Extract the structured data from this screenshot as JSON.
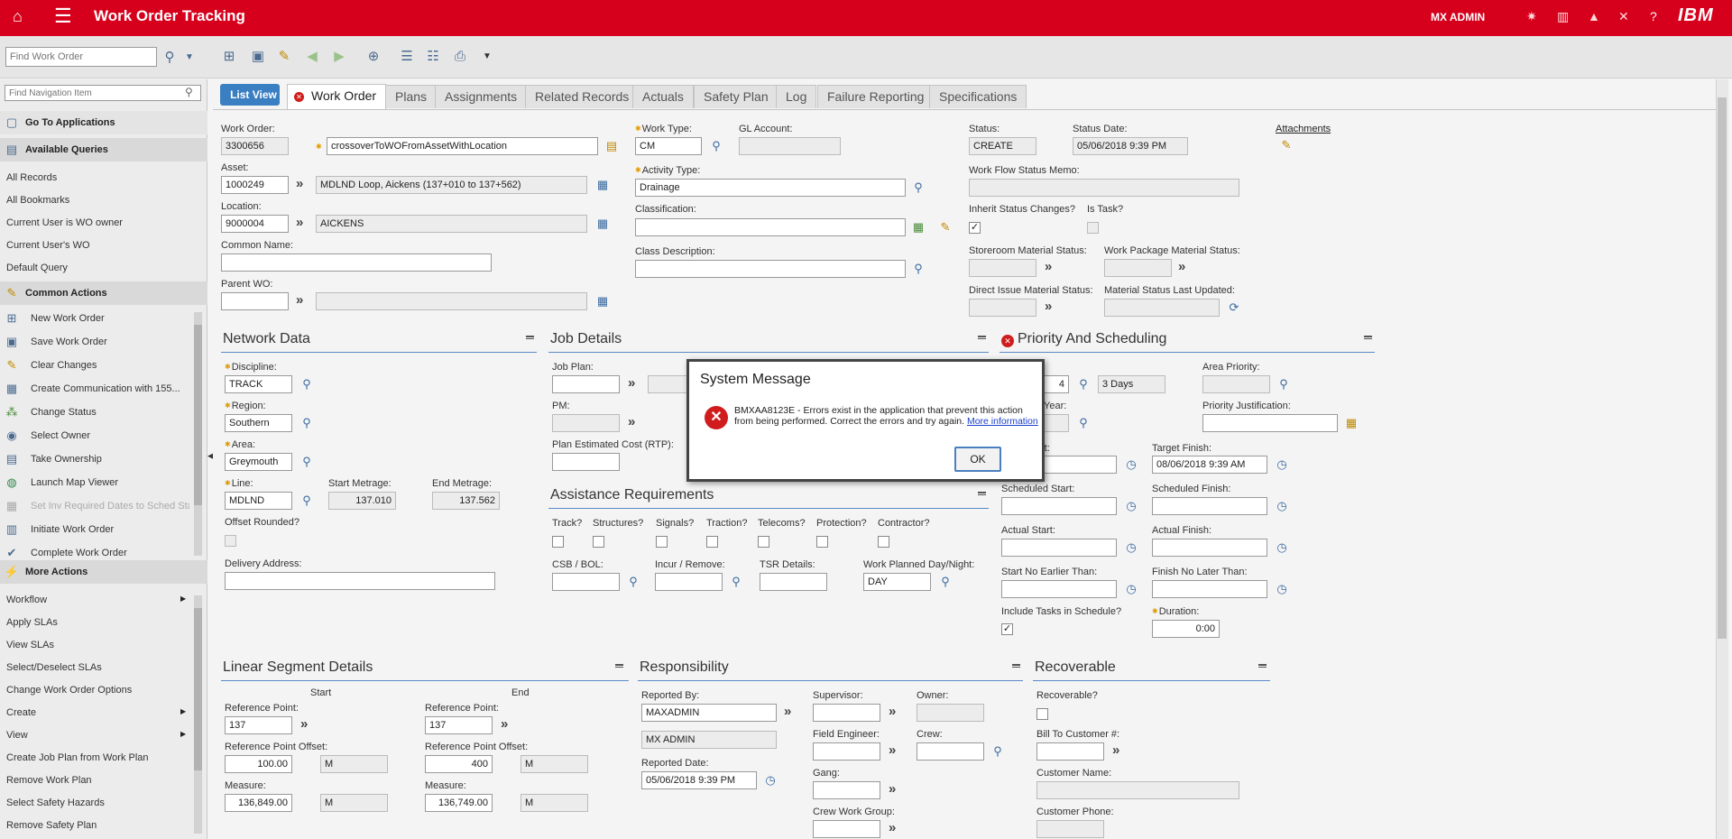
{
  "app": {
    "title": "Work Order Tracking",
    "user": "MX ADMIN",
    "brand": "IBM",
    "accent": "#d6001c"
  },
  "toolbar": {
    "find_placeholder": "Find Work Order"
  },
  "nav": {
    "search_placeholder": "Find Navigation Item",
    "go_to_apps": "Go To Applications",
    "available_queries": "Available Queries",
    "queries": [
      "All Records",
      "All Bookmarks",
      "Current User is WO owner",
      "Current User's WO",
      "Default Query"
    ],
    "common_actions": "Common Actions",
    "actions": [
      "New Work Order",
      "Save Work Order",
      "Clear Changes",
      "Create Communication with 155...",
      "Change Status",
      "Select Owner",
      "Take Ownership",
      "Launch Map Viewer",
      "Set Inv Required Dates to Sched Sta",
      "Initiate Work Order",
      "Complete Work Order"
    ],
    "more_actions": "More Actions",
    "more": [
      "Workflow",
      "Apply SLAs",
      "View SLAs",
      "Select/Deselect SLAs",
      "Change Work Order Options",
      "Create",
      "View",
      "Create Job Plan from Work Plan",
      "Remove Work Plan",
      "Select Safety Hazards",
      "Remove Safety Plan"
    ]
  },
  "tabs": {
    "list_view": "List View",
    "items": [
      "Work Order",
      "Plans",
      "Assignments",
      "Related Records",
      "Actuals",
      "Safety Plan",
      "Log",
      "Failure Reporting",
      "Specifications"
    ]
  },
  "header": {
    "wo_label": "Work Order:",
    "wo": "3300656",
    "desc": "crossoverToWOFromAssetWithLocation",
    "asset_label": "Asset:",
    "asset": "1000249",
    "asset_desc": "MDLND Loop, Aickens (137+010 to 137+562)",
    "location_label": "Location:",
    "location": "9000004",
    "location_desc": "AICKENS",
    "common_name_label": "Common Name:",
    "parent_wo_label": "Parent WO:",
    "work_type_label": "Work Type:",
    "work_type": "CM",
    "gl_label": "GL Account:",
    "activity_label": "Activity Type:",
    "activity": "Drainage",
    "classification_label": "Classification:",
    "class_desc_label": "Class Description:",
    "status_label": "Status:",
    "status": "CREATE",
    "status_date_label": "Status Date:",
    "status_date": "05/06/2018 9:39 PM",
    "attachments": "Attachments",
    "memo_label": "Work Flow Status Memo:",
    "inherit_label": "Inherit Status Changes?",
    "is_task_label": "Is Task?",
    "storeroom_label": "Storeroom Material Status:",
    "work_pkg_label": "Work Package Material Status:",
    "direct_label": "Direct Issue Material Status:",
    "mat_updated_label": "Material Status Last Updated:"
  },
  "network": {
    "title": "Network Data",
    "discipline_label": "Discipline:",
    "discipline": "TRACK",
    "region_label": "Region:",
    "region": "Southern",
    "area_label": "Area:",
    "area": "Greymouth",
    "line_label": "Line:",
    "line": "MDLND",
    "start_label": "Start Metrage:",
    "start": "137.010",
    "end_label": "End Metrage:",
    "end": "137.562",
    "offset_label": "Offset Rounded?",
    "delivery_label": "Delivery Address:"
  },
  "job": {
    "title": "Job Details",
    "job_plan_label": "Job Plan:",
    "pm_label": "PM:",
    "cost_label": "Plan Estimated Cost (RTP):"
  },
  "assist": {
    "title": "Assistance Requirements",
    "checks": [
      "Track?",
      "Structures?",
      "Signals?",
      "Traction?",
      "Telecoms?",
      "Protection?",
      "Contractor?"
    ],
    "csb_label": "CSB / BOL:",
    "incur_label": "Incur / Remove:",
    "tsr_label": "TSR Details:",
    "planned_label": "Work Planned Day/Night:",
    "planned": "DAY"
  },
  "priority": {
    "title": "Priority And Scheduling",
    "area_priority_label": "Area Priority:",
    "priority_val": "4",
    "days": "3 Days",
    "year_label": "Year:",
    "justification_label": "Priority Justification:",
    "start_short": "rt:",
    "target_finish_label": "Target Finish:",
    "target_finish": "08/06/2018 9:39 AM",
    "sched_start_label": "Scheduled Start:",
    "sched_finish_label": "Scheduled Finish:",
    "actual_start_label": "Actual Start:",
    "actual_finish_label": "Actual Finish:",
    "sne_label": "Start No Earlier Than:",
    "fnl_label": "Finish No Later Than:",
    "include_label": "Include Tasks in Schedule?",
    "duration_label": "Duration:",
    "duration": "0:00"
  },
  "linear": {
    "title": "Linear Segment Details",
    "start": "Start",
    "end": "End",
    "ref_label": "Reference Point:",
    "ref_start": "137",
    "ref_end": "137",
    "offset_label": "Reference Point Offset:",
    "offset_start": "100.00",
    "offset_end": "400",
    "unit": "M",
    "measure_label": "Measure:",
    "measure_start": "136,849.00",
    "measure_end": "136,749.00"
  },
  "resp": {
    "title": "Responsibility",
    "reported_by_label": "Reported By:",
    "reported_by": "MAXADMIN",
    "reported_name": "MX ADMIN",
    "reported_date_label": "Reported Date:",
    "reported_date": "05/06/2018 9:39 PM",
    "supervisor_label": "Supervisor:",
    "owner_label": "Owner:",
    "field_eng_label": "Field Engineer:",
    "crew_label": "Crew:",
    "gang_label": "Gang:",
    "crew_group_label": "Crew Work Group:"
  },
  "recov": {
    "title": "Recoverable",
    "recoverable_label": "Recoverable?",
    "bill_label": "Bill To Customer #:",
    "cust_name_label": "Customer Name:",
    "cust_phone_label": "Customer Phone:"
  },
  "dialog": {
    "title": "System Message",
    "message": "BMXAA8123E - Errors exist in the application that prevent this action from being performed. Correct the errors and try again.",
    "link": "More information",
    "ok": "OK"
  }
}
